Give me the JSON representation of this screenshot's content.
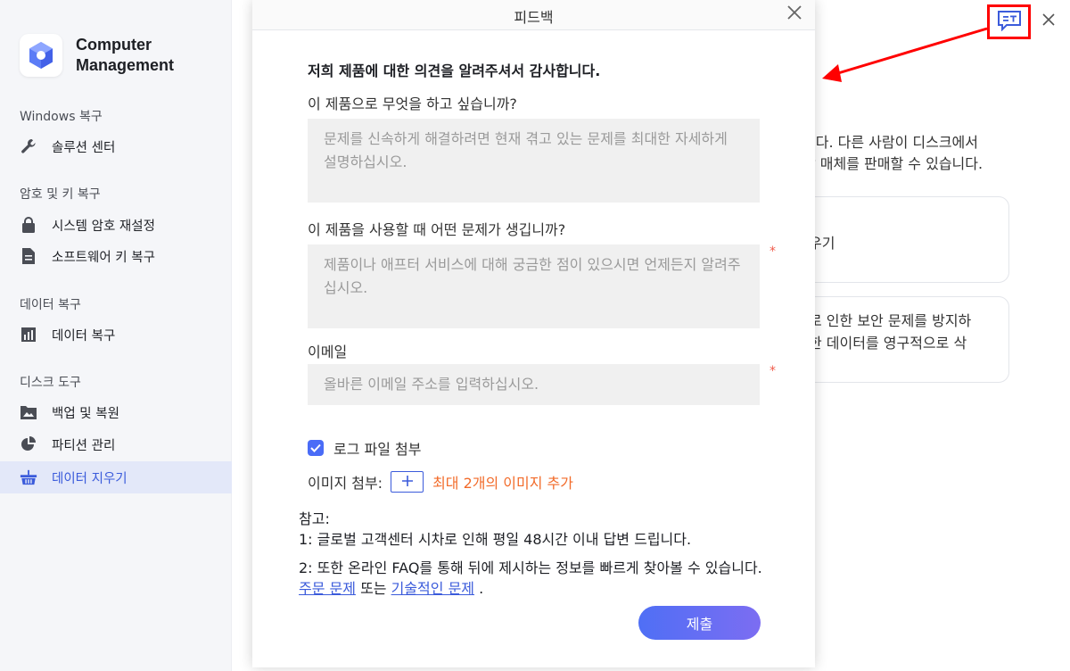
{
  "app": {
    "name_line1": "Computer",
    "name_line2": "Management"
  },
  "sidebar": {
    "sections": [
      {
        "title": "Windows 복구",
        "items": [
          {
            "label": "솔루션 센터",
            "icon": "wrench-icon"
          }
        ]
      },
      {
        "title": "암호 및 키 복구",
        "items": [
          {
            "label": "시스템 암호 재설정",
            "icon": "lock-icon"
          },
          {
            "label": "소프트웨어 키 복구",
            "icon": "document-icon"
          }
        ]
      },
      {
        "title": "데이터 복구",
        "items": [
          {
            "label": "데이터 복구",
            "icon": "bar-chart-icon"
          }
        ]
      },
      {
        "title": "디스크 도구",
        "items": [
          {
            "label": "백업 및 복원",
            "icon": "folder-image-icon"
          },
          {
            "label": "파티션 관리",
            "icon": "pie-chart-icon"
          },
          {
            "label": "데이터 지우기",
            "icon": "basket-icon",
            "active": true
          }
        ]
      }
    ]
  },
  "background": {
    "desc_line1": "니다. 다른 사람이 디스크에서",
    "desc_line2": "장 매체를 판매할 수 있습니다.",
    "card1_text": "우기",
    "card2_line1": "로 인한 보안 문제를 방지하",
    "card2_line2": "한 데이터를 영구적으로 삭"
  },
  "dialog": {
    "title": "피드백",
    "thanks": "저희 제품에 대한 의견을 알려주셔서 감사합니다.",
    "q1_label": "이 제품으로 무엇을 하고 싶습니까?",
    "q1_placeholder": "문제를 신속하게 해결하려면 현재 겪고 있는 문제를 최대한 자세하게 설명하십시오.",
    "q2_label": "이 제품을 사용할 때 어떤 문제가 생깁니까?",
    "q2_placeholder": "제품이나 애프터 서비스에 대해 궁금한 점이 있으시면 언제든지 알려주십시오.",
    "email_label": "이메일",
    "email_placeholder": "올바른 이메일 주소를 입력하십시오.",
    "required_mark": "*",
    "attach_log_label": "로그 파일 첨부",
    "attach_log_checked": true,
    "attach_image_label": "이미지 첨부:",
    "attach_image_limit": "최대 2개의 이미지 추가",
    "notes_title": "참고:",
    "note1": "1: 글로벌 고객센터 시차로 인해 평일 48시간 이내 답변 드립니다.",
    "note2_prefix": "2: 또한 온라인 FAQ를 통해 뒤에 제시하는 정보를 빠르게 찾아볼 수 있습니다.",
    "note2_link1": "주문 문제",
    "note2_mid": "또는",
    "note2_link2": "기술적인 문제",
    "note2_end": ".",
    "submit_label": "제출"
  },
  "colors": {
    "accent": "#3b5bdb",
    "highlight_box": "#ff0000",
    "warning_orange": "#f26b2a",
    "required_red": "#f05a4a"
  }
}
